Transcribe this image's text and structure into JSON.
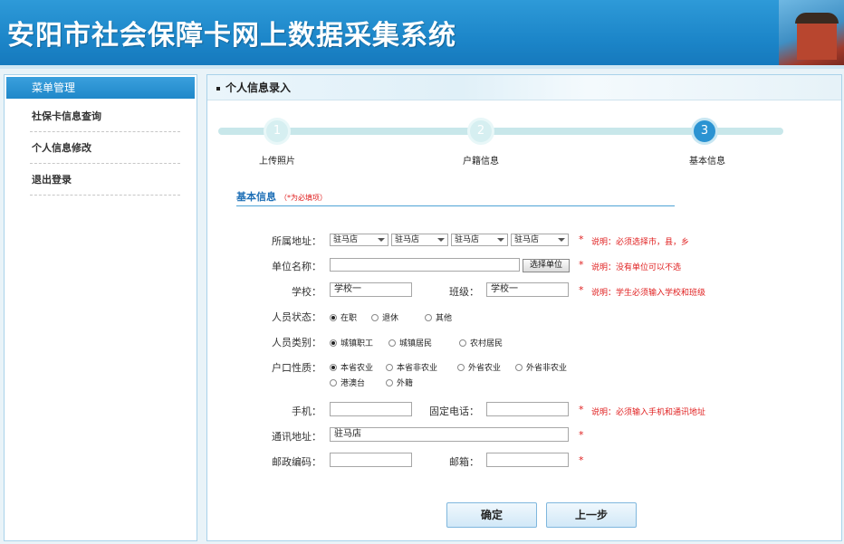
{
  "header": {
    "title": "安阳市社会保障卡网上数据采集系统"
  },
  "sidebar": {
    "title": "菜单管理",
    "items": [
      {
        "label": "社保卡信息查询"
      },
      {
        "label": "个人信息修改"
      },
      {
        "label": "退出登录"
      }
    ]
  },
  "main": {
    "title": "个人信息录入",
    "steps": [
      {
        "number": "1",
        "label": "上传照片"
      },
      {
        "number": "2",
        "label": "户籍信息"
      },
      {
        "number": "3",
        "label": "基本信息"
      }
    ],
    "section": {
      "title": "基本信息",
      "required_note": "（*为必填项）"
    }
  },
  "form": {
    "address_label": "所属地址：",
    "address_selects": [
      "驻马店",
      "驻马店",
      "驻马店",
      "驻马店"
    ],
    "address_note": "说明：必须选择市，县，乡",
    "unit_label": "单位名称：",
    "unit_value": "",
    "unit_button": "选择单位",
    "unit_note": "说明：没有单位可以不选",
    "school_label": "学校：",
    "school_value": "学校一",
    "class_label": "班级：",
    "class_value": "学校一",
    "school_note": "说明：学生必须输入学校和班级",
    "status_label": "人员状态：",
    "status_options": [
      "在职",
      "退休",
      "其他"
    ],
    "category_label": "人员类别：",
    "category_options": [
      "城镇职工",
      "城镇居民",
      "农村居民"
    ],
    "hukou_label": "户口性质：",
    "hukou_options": [
      "本省农业",
      "本省非农业",
      "外省农业",
      "外省非农业",
      "港澳台",
      "外籍"
    ],
    "phone_label": "手机：",
    "phone_value": "",
    "tel_label": "固定电话：",
    "tel_value": "",
    "phone_note": "说明：必须输入手机和通讯地址",
    "addr_label": "通讯地址：",
    "addr_value": "驻马店",
    "zip_label": "邮政编码：",
    "zip_value": "",
    "email_label": "邮箱：",
    "email_value": "",
    "required_star": "*"
  },
  "buttons": {
    "confirm": "确定",
    "prev": "上一步"
  }
}
